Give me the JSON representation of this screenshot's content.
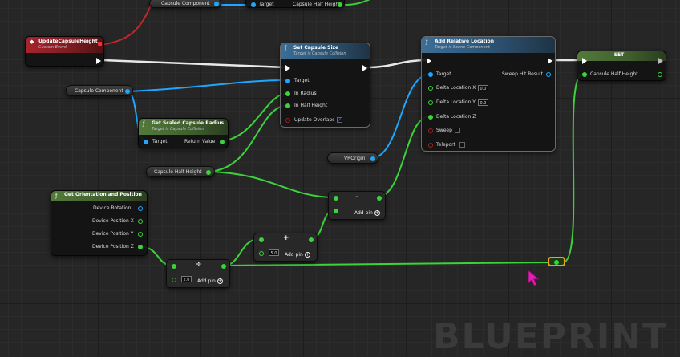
{
  "graph": {
    "watermark": "BLUEPRINT",
    "accent_colors": {
      "exec": "#ffffff",
      "float": "#3cd23c",
      "object": "#1fa6ff",
      "event": "#a8242c",
      "reroute": "#f0a11a"
    }
  },
  "top_getter": {
    "capsule_component": "Capsule Component",
    "target": "Target",
    "capsule_half_height": "Capsule Half Height"
  },
  "event_node": {
    "title": "UpdateCapsuleHeight",
    "subtitle": "Custom Event",
    "icon": "event-diamond-icon"
  },
  "set_capsule_size": {
    "title": "Set Capsule Size",
    "subtitle": "Target is Capsule Collision",
    "pins": {
      "target": "Target",
      "in_radius": "In Radius",
      "in_half_height": "In Half Height",
      "update_overlaps": "Update Overlaps"
    },
    "update_overlaps_checked": true
  },
  "capsule_component_var": {
    "label": "Capsule Component"
  },
  "get_scaled_radius": {
    "title": "Get Scaled Capsule Radius",
    "subtitle": "Target is Capsule Collision",
    "pins": {
      "target": "Target",
      "return_value": "Return Value"
    }
  },
  "add_relative_location": {
    "title": "Add Relative Location",
    "subtitle": "Target is Scene Component",
    "pins": {
      "target": "Target",
      "sweep_hit_result": "Sweep Hit Result",
      "delta_x": "Delta Location X",
      "delta_x_value": "0.0",
      "delta_y": "Delta Location Y",
      "delta_y_value": "0.0",
      "delta_z": "Delta Location Z",
      "sweep": "Sweep",
      "teleport": "Teleport"
    }
  },
  "set_node": {
    "title": "SET",
    "pin": "Capsule Half Height"
  },
  "vr_origin": {
    "label": "VROrigin"
  },
  "capsule_half_height_var": {
    "label": "Capsule Half Height"
  },
  "get_orientation": {
    "title": "Get Orientation and Position",
    "pins": {
      "rotation": "Device Rotation",
      "pos_x": "Device Position X",
      "pos_y": "Device Position Y",
      "pos_z": "Device Position Z"
    }
  },
  "subtract_node": {
    "op": "-",
    "add_pin": "Add pin"
  },
  "add_node": {
    "op": "+",
    "value": "5.0",
    "add_pin": "Add pin"
  },
  "divide_node": {
    "op": "÷",
    "value": "2.0",
    "add_pin": "Add pin"
  }
}
